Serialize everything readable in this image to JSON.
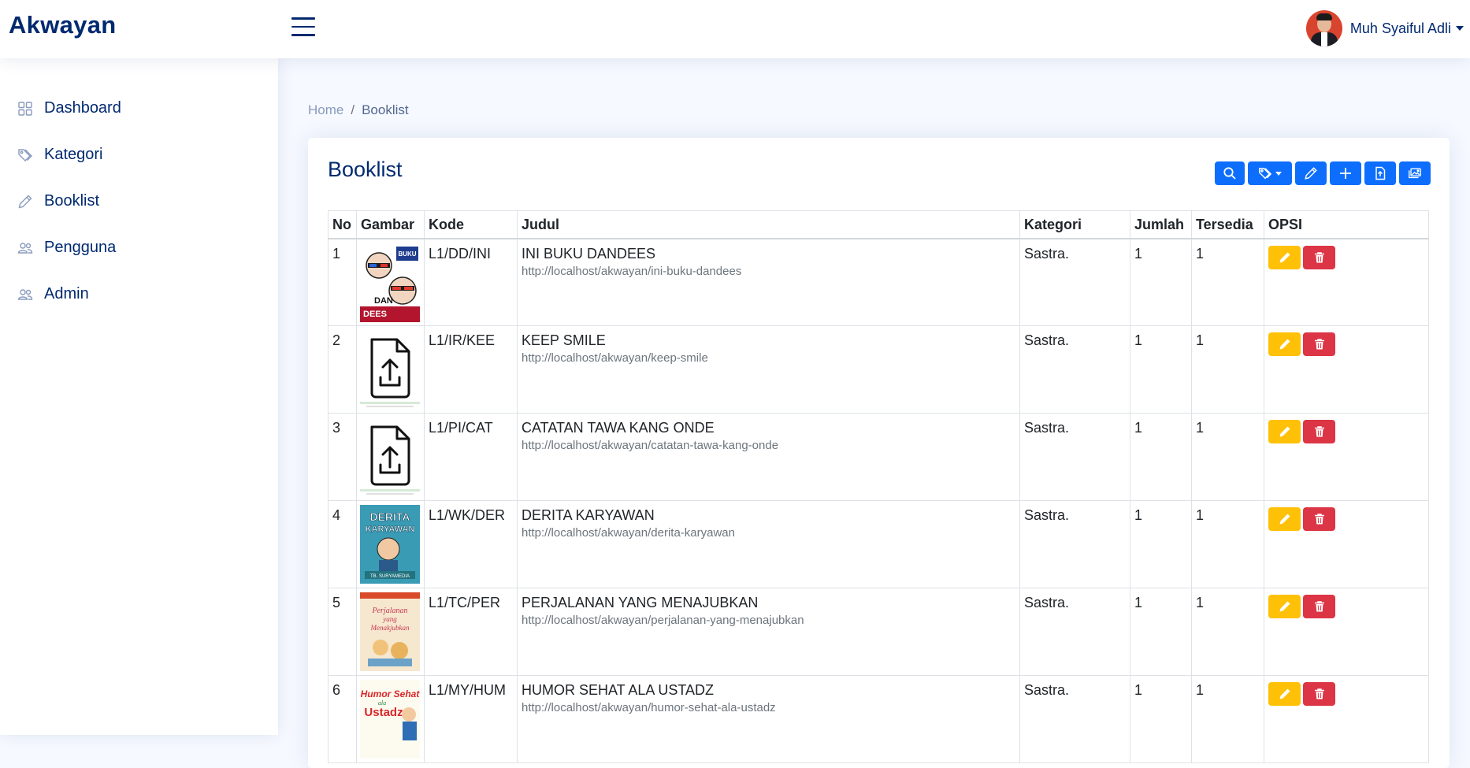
{
  "header": {
    "logo": "Akwayan",
    "user_name": "Muh Syaiful Adli"
  },
  "sidebar": {
    "items": [
      {
        "label": "Dashboard",
        "icon": "grid-icon"
      },
      {
        "label": "Kategori",
        "icon": "tags-icon"
      },
      {
        "label": "Booklist",
        "icon": "pencil-icon"
      },
      {
        "label": "Pengguna",
        "icon": "people-icon"
      },
      {
        "label": "Admin",
        "icon": "people-icon"
      }
    ]
  },
  "breadcrumb": {
    "home": "Home",
    "separator": "/",
    "current": "Booklist"
  },
  "card": {
    "title": "Booklist",
    "toolbar": [
      "search-icon",
      "tags-dropdown-icon",
      "pencil-icon",
      "plus-icon",
      "file-upload-icon",
      "images-icon"
    ]
  },
  "table": {
    "headers": [
      "No",
      "Gambar",
      "Kode",
      "Judul",
      "Kategori",
      "Jumlah",
      "Tersedia",
      "OPSI"
    ],
    "rows": [
      {
        "no": "1",
        "image": "cover-ini-buku-dandees",
        "kode": "L1/DD/INI",
        "judul": "INI BUKU DANDEES",
        "slug": "http://localhost/akwayan/ini-buku-dandees",
        "kategori": "Sastra.",
        "jumlah": "1",
        "tersedia": "1"
      },
      {
        "no": "2",
        "image": "file-upload-placeholder",
        "kode": "L1/IR/KEE",
        "judul": "KEEP SMILE",
        "slug": "http://localhost/akwayan/keep-smile",
        "kategori": "Sastra.",
        "jumlah": "1",
        "tersedia": "1"
      },
      {
        "no": "3",
        "image": "file-upload-placeholder",
        "kode": "L1/PI/CAT",
        "judul": "CATATAN TAWA KANG ONDE",
        "slug": "http://localhost/akwayan/catatan-tawa-kang-onde",
        "kategori": "Sastra.",
        "jumlah": "1",
        "tersedia": "1"
      },
      {
        "no": "4",
        "image": "cover-derita-karyawan",
        "kode": "L1/WK/DER",
        "judul": "DERITA KARYAWAN",
        "slug": "http://localhost/akwayan/derita-karyawan",
        "kategori": "Sastra.",
        "jumlah": "1",
        "tersedia": "1"
      },
      {
        "no": "5",
        "image": "cover-perjalanan-yang-menajubkan",
        "kode": "L1/TC/PER",
        "judul": "PERJALANAN YANG MENAJUBKAN",
        "slug": "http://localhost/akwayan/perjalanan-yang-menajubkan",
        "kategori": "Sastra.",
        "jumlah": "1",
        "tersedia": "1"
      },
      {
        "no": "6",
        "image": "cover-humor-sehat-ala-ustadz",
        "kode": "L1/MY/HUM",
        "judul": "HUMOR SEHAT ALA USTADZ",
        "slug": "http://localhost/akwayan/humor-sehat-ala-ustadz",
        "kategori": "Sastra.",
        "jumlah": "1",
        "tersedia": "1"
      }
    ]
  },
  "colors": {
    "brand": "#012970",
    "primary": "#0d6efd",
    "warning": "#ffc107",
    "danger": "#dc3545",
    "background": "#f6f9ff"
  }
}
